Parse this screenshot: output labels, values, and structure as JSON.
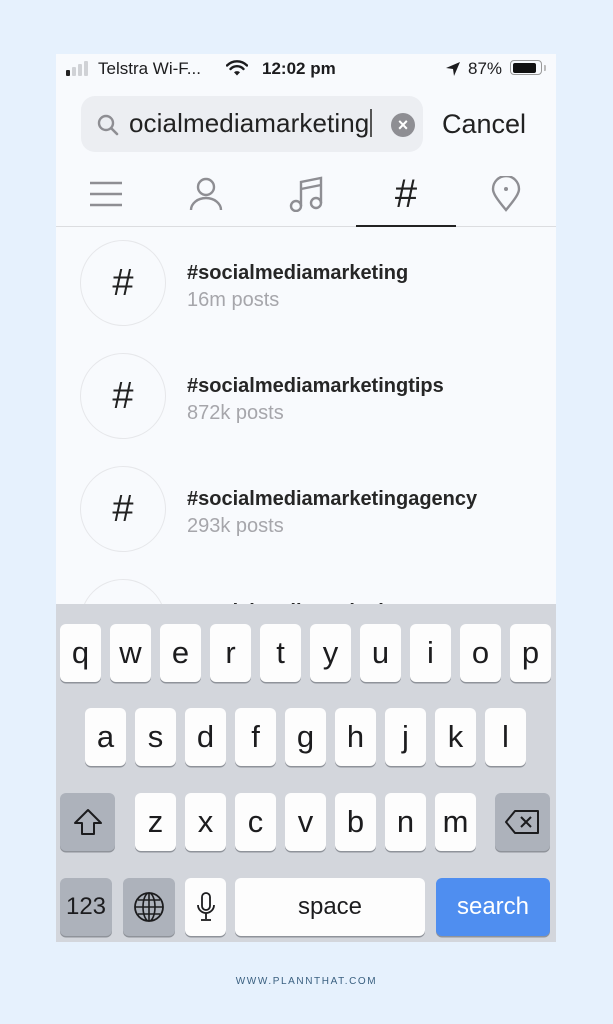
{
  "status_bar": {
    "carrier": "Telstra Wi-F...",
    "time": "12:02 pm",
    "battery_percent": "87%",
    "battery_level": 0.87,
    "signal_bars_active": 1,
    "signal_bars_total": 4
  },
  "search": {
    "query": "ocialmediamarketing",
    "cancel_label": "Cancel"
  },
  "tabs": [
    {
      "name": "top",
      "icon": "menu-icon",
      "active": false
    },
    {
      "name": "accounts",
      "icon": "person-icon",
      "active": false
    },
    {
      "name": "audio",
      "icon": "music-note-icon",
      "active": false
    },
    {
      "name": "tags",
      "icon": "hashtag-icon",
      "label": "#",
      "active": true
    },
    {
      "name": "places",
      "icon": "location-pin-icon",
      "active": false
    }
  ],
  "results": [
    {
      "icon": "#",
      "tag": "#socialmediamarketing",
      "count": "16m posts"
    },
    {
      "icon": "#",
      "tag": "#socialmediamarketingtips",
      "count": "872k posts"
    },
    {
      "icon": "#",
      "tag": "#socialmediamarketingagency",
      "count": "293k posts"
    },
    {
      "icon": "#",
      "tag": "#socialmediamarketingtoto",
      "count": ""
    }
  ],
  "keyboard": {
    "row1": [
      "q",
      "w",
      "e",
      "r",
      "t",
      "y",
      "u",
      "i",
      "o",
      "p"
    ],
    "row2": [
      "a",
      "s",
      "d",
      "f",
      "g",
      "h",
      "j",
      "k",
      "l"
    ],
    "row3": [
      "z",
      "x",
      "c",
      "v",
      "b",
      "n",
      "m"
    ],
    "numbers_label": "123",
    "space_label": "space",
    "search_label": "search"
  },
  "colors": {
    "search_key": "#4f8ef0",
    "page_background": "#e6f1fd"
  },
  "footer": {
    "text": "WWW.PLANNTHAT.COM"
  }
}
